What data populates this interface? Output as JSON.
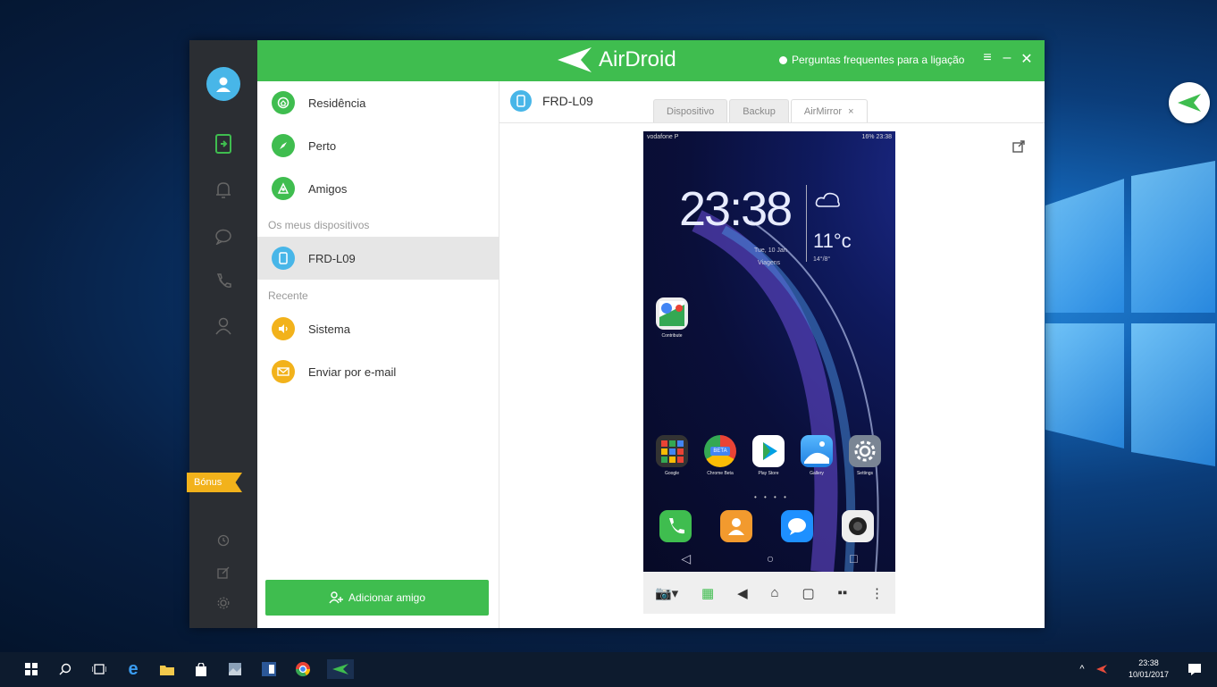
{
  "app": {
    "title": "AirDroid",
    "faq": "Perguntas frequentes para a ligação"
  },
  "rail": {
    "bonus": "Bónus"
  },
  "list": {
    "items": [
      {
        "label": "Residência",
        "color": "#3fbd4f"
      },
      {
        "label": "Perto",
        "color": "#3fbd4f"
      },
      {
        "label": "Amigos",
        "color": "#3fbd4f"
      }
    ],
    "section_devices": "Os meus dispositivos",
    "device": {
      "label": "FRD-L09",
      "color": "#48b6e8"
    },
    "section_recent": "Recente",
    "recent": [
      {
        "label": "Sistema",
        "color": "#f2b21b"
      },
      {
        "label": "Enviar por e-mail",
        "color": "#f2b21b"
      }
    ],
    "add_friend": "Adicionar amigo"
  },
  "main": {
    "device_title": "FRD-L09",
    "tabs": [
      "Dispositivo",
      "Backup",
      "AirMirror"
    ],
    "tab_close": "×"
  },
  "phone": {
    "carrier": "vodafone P",
    "status_right": "16% 23:38",
    "clock": "23:38",
    "date": "Tue, 10 Jan",
    "location": "Viagens",
    "temp": "11°c",
    "temp_range": "14°/8°",
    "apps": [
      {
        "label": "Contribute"
      },
      {
        "label": "Google"
      },
      {
        "label": "Chrome Beta"
      },
      {
        "label": "Play Store"
      },
      {
        "label": "Gallery"
      },
      {
        "label": "Settings"
      }
    ],
    "chrome_badge": "BETA"
  },
  "taskbar": {
    "time": "23:38",
    "date": "10/01/2017"
  }
}
